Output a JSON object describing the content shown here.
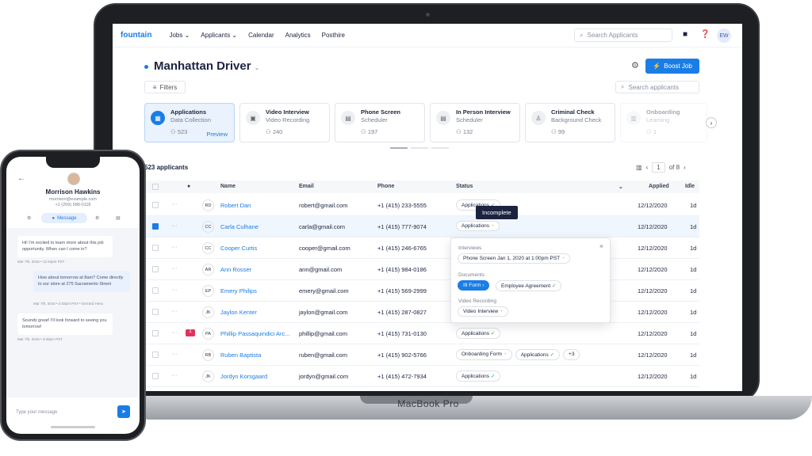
{
  "nav": {
    "logo": "fountain",
    "items": [
      "Jobs",
      "Applicants",
      "Calendar",
      "Analytics",
      "Posthire"
    ],
    "search_placeholder": "Search Applicants",
    "user_initials": "EW"
  },
  "job": {
    "title": "Manhattan Driver",
    "boost_label": "Boost Job",
    "filters_label": "Filters",
    "search_placeholder": "Search applicants"
  },
  "stages": [
    {
      "title": "Applications",
      "subtitle": "Data Collection",
      "count": "523",
      "extra": "Preview"
    },
    {
      "title": "Video Interview",
      "subtitle": "Video Recording",
      "count": "240"
    },
    {
      "title": "Phone Screen",
      "subtitle": "Scheduler",
      "count": "197"
    },
    {
      "title": "In Person Interview",
      "subtitle": "Scheduler",
      "count": "132"
    },
    {
      "title": "Criminal Check",
      "subtitle": "Background Check",
      "count": "99"
    },
    {
      "title": "Onboarding",
      "subtitle": "Learning",
      "count": "1"
    }
  ],
  "table": {
    "count_label": "523 applicants",
    "page": "1",
    "page_total": "of 8",
    "headers": [
      "Name",
      "Email",
      "Phone",
      "Status",
      "Applied",
      "Idle"
    ],
    "rows": [
      {
        "ini": "RD",
        "name": "Robert Dan",
        "email": "robert@gmail.com",
        "phone": "+1 (415) 233-5555",
        "status": "Applications",
        "applied": "12/12/2020",
        "idle": "1d"
      },
      {
        "ini": "CC",
        "name": "Carla Culhane",
        "email": "carla@gmail.com",
        "phone": "+1 (415) 777-9074",
        "status": "Applications",
        "applied": "12/12/2020",
        "idle": "1d"
      },
      {
        "ini": "CC",
        "name": "Cooper Curtis",
        "email": "cooper@gmail.com",
        "phone": "+1 (415) 246-6765",
        "status": "",
        "applied": "12/12/2020",
        "idle": "1d"
      },
      {
        "ini": "AR",
        "name": "Ann Rosser",
        "email": "ann@gmail.com",
        "phone": "+1 (415) 984-0186",
        "status": "",
        "applied": "12/12/2020",
        "idle": "1d"
      },
      {
        "ini": "EP",
        "name": "Emery Philips",
        "email": "emery@gmail.com",
        "phone": "+1 (415) 569-2999",
        "status": "",
        "applied": "12/12/2020",
        "idle": "1d"
      },
      {
        "ini": "JK",
        "name": "Jaylon Kenter",
        "email": "jaylon@gmail.com",
        "phone": "+1 (415) 287-0827",
        "status": "",
        "applied": "12/12/2020",
        "idle": "1d"
      },
      {
        "ini": "PA",
        "name": "Phillip Passaquindici Arc...",
        "email": "phillip@gmail.com",
        "phone": "+1 (415) 731-0130",
        "status": "Applications",
        "applied": "12/12/2020",
        "idle": "1d",
        "badge": "1"
      },
      {
        "ini": "RB",
        "name": "Ruben Baptista",
        "email": "ruben@gmail.com",
        "phone": "+1 (415) 902-5766",
        "status": "Onboarding Form",
        "status2": "Applications",
        "more": "+3",
        "applied": "12/12/2020",
        "idle": "1d"
      },
      {
        "ini": "JK",
        "name": "Jordyn Korsgaard",
        "email": "jordyn@gmail.com",
        "phone": "+1 (415) 472-7934",
        "status": "Applications",
        "applied": "12/12/2020",
        "idle": "1d"
      }
    ]
  },
  "tooltip": "Incomplete",
  "popover": {
    "interviews_label": "Interviews",
    "interview_chip": "Phone Screen Jan 1, 2020 at 1:00pm PST",
    "documents_label": "Documents",
    "doc1": "I9 Form",
    "doc2": "Employee Agreement",
    "video_label": "Video Recording",
    "video_chip": "Video Interview"
  },
  "device_label": "MacBook Pro",
  "phone": {
    "name": "Morrison Hawkins",
    "email": "morrison@example.com",
    "phone": "+1 (209) 588-0118",
    "tab_message": "Message",
    "msg1": "Hi! I'm excited to learn more about this job opportunity. When can I come in?",
    "meta1": "Mar 7th, 2016 • 12:40pm PST",
    "msg2": "How about tomorrow at 8am? Come directly to our store at 275 Sacramento Street",
    "meta2": "Mar 7th, 2016 • 2:03pm PST • Gerrard Hess",
    "msg3": "Sounds great! I'll look forward to seeing you tomorrow!",
    "meta3": "Mar 7th, 2016 • 3:46pm PST",
    "input_placeholder": "Type your message"
  },
  "colors": {
    "accent": "#1a7de6",
    "success": "#21a060",
    "pending": "#f2a322",
    "badge": "#e0335a",
    "dark": "#1b2340"
  }
}
